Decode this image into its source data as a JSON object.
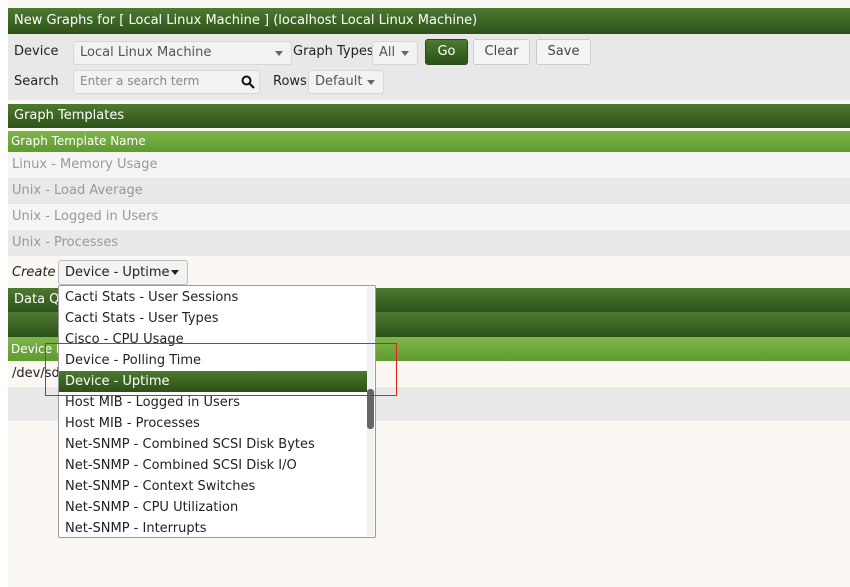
{
  "title": "New Graphs for [ Local Linux Machine ] (localhost Local Linux Machine)",
  "filter": {
    "device_label": "Device",
    "device_value": "Local Linux Machine",
    "graph_types_label": "Graph Types",
    "graph_types_value": "All",
    "go_label": "Go",
    "clear_label": "Clear",
    "save_label": "Save",
    "search_label": "Search",
    "search_placeholder": "Enter a search term",
    "rows_label": "Rows",
    "rows_value": "Default"
  },
  "graph_templates": {
    "header": "Graph Templates",
    "column_header": "Graph Template Name",
    "rows": [
      "Linux - Memory Usage",
      "Unix - Load Average",
      "Unix - Logged in Users",
      "Unix - Processes"
    ],
    "create_label": "Create",
    "create_value": "Device - Uptime"
  },
  "data_query": {
    "header_partial": "Data Q",
    "col_partial": "Device N",
    "row_partial": "/dev/sd"
  },
  "dropdown": {
    "items": [
      "Cacti Stats - User Sessions",
      "Cacti Stats - User Types",
      "Cisco - CPU Usage",
      "Device - Polling Time",
      "Device - Uptime",
      "Host MIB - Logged in Users",
      "Host MIB - Processes",
      "Net-SNMP - Combined SCSI Disk Bytes",
      "Net-SNMP - Combined SCSI Disk I/O",
      "Net-SNMP - Context Switches",
      "Net-SNMP - CPU Utilization",
      "Net-SNMP - Interrupts"
    ],
    "selected": "Device - Uptime"
  },
  "colors": {
    "header_dark_green": "#2d5219",
    "subheader_green": "#6ea63c",
    "highlight_red": "#e0201e"
  }
}
